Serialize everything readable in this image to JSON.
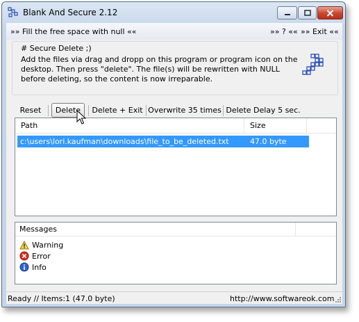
{
  "window": {
    "title": "Blank And Secure 2.12"
  },
  "menu": {
    "fill_free_space": "»» Fill the free space with null ««",
    "help": "»» ? ««",
    "exit": "»» Exit ««"
  },
  "info": {
    "title": "# Secure Delete ;)",
    "text": "Add the files via drag and dropp on this program or program icon on the desktop. Then press \"delete\". The file(s) will be rewritten with NULL before deleting, so the content is now irreparable."
  },
  "toolbar": {
    "reset": "Reset",
    "delete": "Delete",
    "delete_exit": "Delete + Exit",
    "overwrite": "Overwrite 35 times",
    "delete_delay": "Delete Delay 5 sec."
  },
  "filelist": {
    "columns": [
      "Path",
      "Size"
    ],
    "rows": [
      {
        "path": "c:\\users\\lori.kaufman\\downloads\\file_to_be_deleted.txt",
        "size": "47.0 byte"
      }
    ]
  },
  "messages": {
    "header": "Messages",
    "items": [
      {
        "label": "Warning",
        "icon": "warning-icon"
      },
      {
        "label": "Error",
        "icon": "error-icon"
      },
      {
        "label": "Info",
        "icon": "info-icon"
      }
    ]
  },
  "status": {
    "left": "Ready // Items:1 (47.0 byte)",
    "right": "http://www.softwareok.com"
  }
}
